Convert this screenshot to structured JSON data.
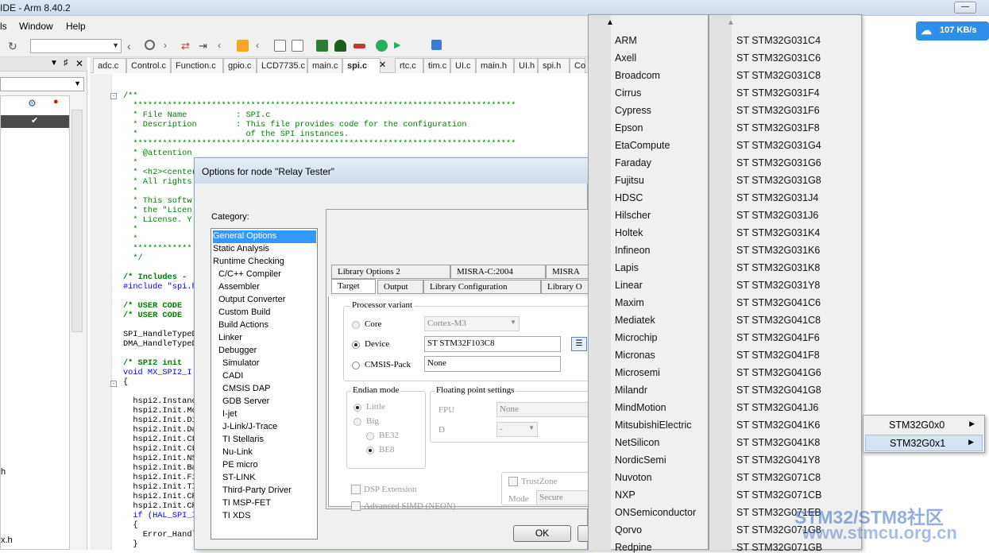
{
  "window": {
    "title": "IDE - Arm 8.40.2"
  },
  "menu": [
    "ls",
    "Window",
    "Help"
  ],
  "left_panel": {
    "file_items": [
      "h",
      "x.h"
    ]
  },
  "editor_tabs": [
    "adc.c",
    "Control.c",
    "Function.c",
    "gpio.c",
    "LCD7735.c",
    "main.c",
    "spi.c",
    "rtc.c",
    "tim.c",
    "UI.c",
    "main.h",
    "UI.h",
    "spi.h",
    "Co"
  ],
  "code_lines": [
    {
      "c": "/**",
      "k": "cmt"
    },
    {
      "c": "  ******************************************************************************",
      "k": "cmt"
    },
    {
      "c": "  * File Name          : SPI.c",
      "k": "cmt"
    },
    {
      "c": "  * Description        : This file provides code for the configuration",
      "k": "cmt"
    },
    {
      "c": "  *                      of the SPI instances.",
      "k": "cmt"
    },
    {
      "c": "  ******************************************************************************",
      "k": "cmt"
    },
    {
      "c": "  * @attention",
      "k": "cmt"
    },
    {
      "c": "  *",
      "k": "cmt"
    },
    {
      "c": "  * <h2><center",
      "k": "cmt"
    },
    {
      "c": "  * All rights",
      "k": "cmt"
    },
    {
      "c": "  *",
      "k": "cmt"
    },
    {
      "c": "  * This softw",
      "k": "cmt"
    },
    {
      "c": "  * the \"Licen",
      "k": "cmt"
    },
    {
      "c": "  * License. Y",
      "k": "cmt"
    },
    {
      "c": "  *",
      "k": "cmt"
    },
    {
      "c": "  *",
      "k": "cmt"
    },
    {
      "c": "  ************",
      "k": "cmt"
    },
    {
      "c": "  */",
      "k": "cmt"
    },
    {
      "c": "",
      "k": ""
    },
    {
      "c": "/* Includes -",
      "k": "cmt-b"
    },
    {
      "c": "#include \"spi.h",
      "k": "kw"
    },
    {
      "c": "",
      "k": ""
    },
    {
      "c": "/* USER CODE",
      "k": "cmt-b"
    },
    {
      "c": "/* USER CODE",
      "k": "cmt-b"
    },
    {
      "c": "",
      "k": ""
    },
    {
      "c": "SPI_HandleTypeD",
      "k": ""
    },
    {
      "c": "DMA_HandleTypeD",
      "k": ""
    },
    {
      "c": "",
      "k": ""
    },
    {
      "c": "/* SPI2 init",
      "k": "cmt-b"
    },
    {
      "c": "void MX_SPI2_I",
      "k": "kw"
    },
    {
      "c": "{",
      "k": ""
    },
    {
      "c": "",
      "k": ""
    },
    {
      "c": "  hspi2.Instanc",
      "k": ""
    },
    {
      "c": "  hspi2.Init.Mo",
      "k": ""
    },
    {
      "c": "  hspi2.Init.Di",
      "k": ""
    },
    {
      "c": "  hspi2.Init.Da",
      "k": ""
    },
    {
      "c": "  hspi2.Init.CL",
      "k": ""
    },
    {
      "c": "  hspi2.Init.CL",
      "k": ""
    },
    {
      "c": "  hspi2.Init.NS",
      "k": ""
    },
    {
      "c": "  hspi2.Init.Ba",
      "k": ""
    },
    {
      "c": "  hspi2.Init.Fi",
      "k": ""
    },
    {
      "c": "  hspi2.Init.TI",
      "k": ""
    },
    {
      "c": "  hspi2.Init.CR",
      "k": ""
    },
    {
      "c": "  hspi2.Init.CR",
      "k": ""
    },
    {
      "c": "  if (HAL_SPI_I",
      "k": "kw"
    },
    {
      "c": "  {",
      "k": ""
    },
    {
      "c": "    Error_Handl",
      "k": ""
    },
    {
      "c": "  }",
      "k": ""
    }
  ],
  "dialog": {
    "title": "Options for node \"Relay Tester\"",
    "category_label": "Category:",
    "categories": [
      {
        "label": "General Options",
        "indent": 0,
        "selected": true
      },
      {
        "label": "Static Analysis",
        "indent": 0
      },
      {
        "label": "Runtime Checking",
        "indent": 0
      },
      {
        "label": "C/C++ Compiler",
        "indent": 1
      },
      {
        "label": "Assembler",
        "indent": 1
      },
      {
        "label": "Output Converter",
        "indent": 1
      },
      {
        "label": "Custom Build",
        "indent": 1
      },
      {
        "label": "Build Actions",
        "indent": 1
      },
      {
        "label": "Linker",
        "indent": 1
      },
      {
        "label": "Debugger",
        "indent": 1
      },
      {
        "label": "Simulator",
        "indent": 2
      },
      {
        "label": "CADI",
        "indent": 2
      },
      {
        "label": "CMSIS DAP",
        "indent": 2
      },
      {
        "label": "GDB Server",
        "indent": 2
      },
      {
        "label": "I-jet",
        "indent": 2
      },
      {
        "label": "J-Link/J-Trace",
        "indent": 2
      },
      {
        "label": "TI Stellaris",
        "indent": 2
      },
      {
        "label": "Nu-Link",
        "indent": 2
      },
      {
        "label": "PE micro",
        "indent": 2
      },
      {
        "label": "ST-LINK",
        "indent": 2
      },
      {
        "label": "Third-Party Driver",
        "indent": 2
      },
      {
        "label": "TI MSP-FET",
        "indent": 2
      },
      {
        "label": "TI XDS",
        "indent": 2
      }
    ],
    "tabs_row1": [
      "Library Options 2",
      "MISRA-C:2004",
      "MISRA"
    ],
    "tabs_row2": [
      "Target",
      "Output",
      "Library Configuration",
      "Library O"
    ],
    "processor_variant": {
      "label": "Processor variant",
      "core_label": "Core",
      "core_value": "Cortex-M3",
      "device_label": "Device",
      "device_value": "ST STM32F103C8",
      "cmsis_label": "CMSIS-Pack",
      "cmsis_value": "None"
    },
    "endian": {
      "label": "Endian mode",
      "little": "Little",
      "big": "Big",
      "be32": "BE32",
      "be8": "BE8"
    },
    "fp": {
      "label": "Floating point settings",
      "fpu_label": "FPU",
      "fpu_value": "None",
      "d_label": "D",
      "d_value": "-"
    },
    "dsp_label": "DSP Extension",
    "simd_label": "Advanced SIMD (NEON)",
    "trustzone": {
      "label": "TrustZone",
      "mode_label": "Mode",
      "mode_value": "Secure"
    },
    "ok_label": "OK"
  },
  "vendors": [
    "ARM",
    "Axell",
    "Broadcom",
    "Cirrus",
    "Cypress",
    "Epson",
    "EtaCompute",
    "Faraday",
    "Fujitsu",
    "HDSC",
    "Hilscher",
    "Holtek",
    "Infineon",
    "Lapis",
    "Linear",
    "Maxim",
    "Mediatek",
    "Microchip",
    "Micronas",
    "Microsemi",
    "Milandr",
    "MindMotion",
    "MitsubishiElectric",
    "NetSilicon",
    "NordicSemi",
    "Nuvoton",
    "NXP",
    "ONSemiconductor",
    "Qorvo",
    "Redpine"
  ],
  "devices": [
    "ST STM32G031C4",
    "ST STM32G031C6",
    "ST STM32G031C8",
    "ST STM32G031F4",
    "ST STM32G031F6",
    "ST STM32G031F8",
    "ST STM32G031G4",
    "ST STM32G031G6",
    "ST STM32G031G8",
    "ST STM32G031J4",
    "ST STM32G031J6",
    "ST STM32G031K4",
    "ST STM32G031K6",
    "ST STM32G031K8",
    "ST STM32G031Y8",
    "ST STM32G041C6",
    "ST STM32G041C8",
    "ST STM32G041F6",
    "ST STM32G041F8",
    "ST STM32G041G6",
    "ST STM32G041G8",
    "ST STM32G041J6",
    "ST STM32G041K6",
    "ST STM32G041K8",
    "ST STM32G041Y8",
    "ST STM32G071C8",
    "ST STM32G071CB",
    "ST STM32G071EB",
    "ST STM32G071G8",
    "ST STM32G071GB"
  ],
  "submenu": [
    {
      "label": "STM32G0x0",
      "highlighted": false
    },
    {
      "label": "STM32G0x1",
      "highlighted": true
    }
  ],
  "net_badge": "107 KB/s",
  "watermark": {
    "line1": "STM32/STM8社区",
    "line2": "www.stmcu.org.cn"
  },
  "colors": {
    "selection": "#3399ff",
    "badge": "#2f8ee8",
    "comment": "#008000",
    "keyword": "#0000ff"
  }
}
